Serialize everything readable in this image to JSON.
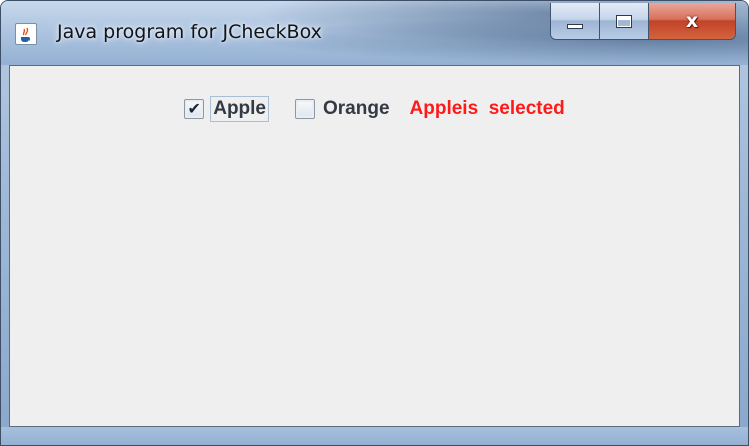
{
  "window": {
    "title": "Java program for JCheckBox",
    "app_icon": "java-cup-icon",
    "caption_buttons": {
      "minimize_icon": "minimize-icon",
      "maximize_icon": "maximize-icon",
      "close_icon": "close-icon",
      "close_glyph": "x"
    }
  },
  "content": {
    "checkboxes": [
      {
        "label": "Apple",
        "checked": true,
        "check_glyph": "✔"
      },
      {
        "label": "Orange",
        "checked": false,
        "check_glyph": ""
      }
    ],
    "status_text": "Appleis  selected",
    "status_color": "#ff1a1a"
  }
}
